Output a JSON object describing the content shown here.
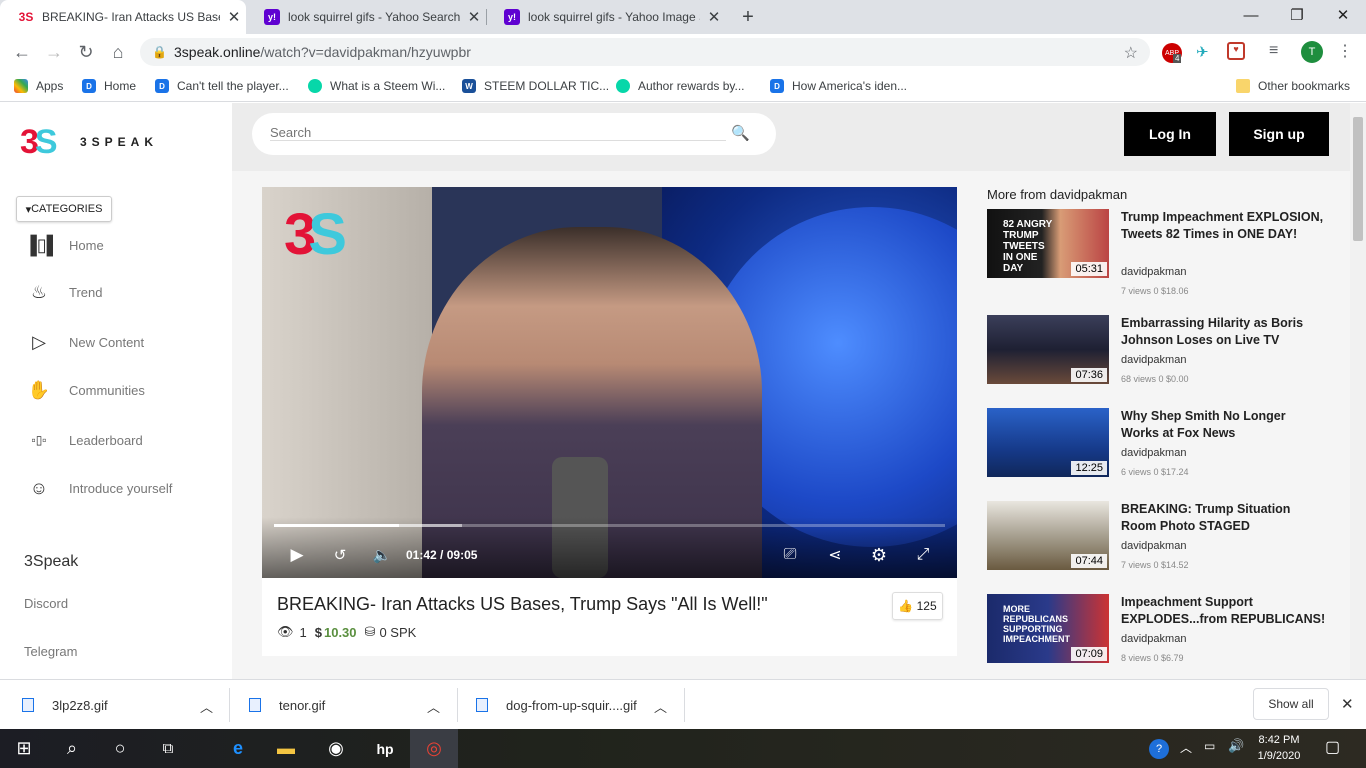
{
  "browser": {
    "tabs": [
      {
        "title": "BREAKING- Iran Attacks US Bases",
        "favicon": "3speak-icon",
        "active": true
      },
      {
        "title": "look squirrel gifs - Yahoo Search",
        "favicon": "yahoo-icon",
        "active": false
      },
      {
        "title": "look squirrel gifs - Yahoo Image S",
        "favicon": "yahoo-icon",
        "active": false
      }
    ],
    "new_tab_label": "+",
    "url_host": "3speak.online",
    "url_path": "/watch?v=davidpakman/hzyuwpbr",
    "extension_badge": "4",
    "profile_initial": "T",
    "bookmarks": [
      {
        "label": "Apps",
        "icon": "apps-grid-icon"
      },
      {
        "label": "Home",
        "icon": "page-icon"
      },
      {
        "label": "Can't tell the player...",
        "icon": "page-icon"
      },
      {
        "label": "What is a Steem Wi...",
        "icon": "steemit-icon"
      },
      {
        "label": "STEEM DOLLAR TIC...",
        "icon": "steem-icon"
      },
      {
        "label": "Author rewards by...",
        "icon": "steemit-icon"
      },
      {
        "label": "How America's iden...",
        "icon": "page-icon"
      }
    ],
    "other_bookmarks": "Other bookmarks"
  },
  "site": {
    "brand": "3SPEAK",
    "categories_label": "CATEGORIES",
    "nav": [
      {
        "label": "Home",
        "icon": "home-icon"
      },
      {
        "label": "Trend",
        "icon": "fire-icon"
      },
      {
        "label": "New Content",
        "icon": "play-outline-icon"
      },
      {
        "label": "Communities",
        "icon": "handshake-icon"
      },
      {
        "label": "Leaderboard",
        "icon": "leaderboard-icon"
      },
      {
        "label": "Introduce yourself",
        "icon": "smile-icon"
      }
    ],
    "section_heading": "3Speak",
    "section_links": [
      "Discord",
      "Telegram"
    ],
    "search_placeholder": "Search",
    "login_label": "Log In",
    "signup_label": "Sign up"
  },
  "video": {
    "title": "BREAKING- Iran Attacks US Bases, Trump Says \"All Is Well!\"",
    "current_time": "01:42",
    "time_separator": "/",
    "duration": "09:05",
    "played_fraction": 0.187,
    "buffered_fraction": 0.28,
    "likes": "125",
    "views": "1",
    "payout": "10.30",
    "payout_symbol": "$",
    "spk": "0 SPK"
  },
  "related": {
    "heading": "More from davidpakman",
    "items": [
      {
        "title": "Trump Impeachment EXPLOSION, Tweets 82 Times in ONE DAY!",
        "author": "davidpakman",
        "duration": "05:31",
        "stats": "7 views 0 $18.06",
        "thumb_text": "82 ANGRY TRUMP TWEETS IN ONE DAY"
      },
      {
        "title": "Embarrassing Hilarity as Boris Johnson Loses on Live TV",
        "author": "davidpakman",
        "duration": "07:36",
        "stats": "68 views 0 $0.00",
        "thumb_text": ""
      },
      {
        "title": "Why Shep Smith No Longer Works at Fox News",
        "author": "davidpakman",
        "duration": "12:25",
        "stats": "6 views 0 $17.24",
        "thumb_text": ""
      },
      {
        "title": "BREAKING: Trump Situation Room Photo STAGED",
        "author": "davidpakman",
        "duration": "07:44",
        "stats": "7 views 0 $14.52",
        "thumb_text": ""
      },
      {
        "title": "Impeachment Support EXPLODES...from REPUBLICANS!",
        "author": "davidpakman",
        "duration": "07:09",
        "stats": "8 views 0 $6.79",
        "thumb_text": "MORE REPUBLICANS SUPPORTING IMPEACHMENT"
      }
    ]
  },
  "downloads": {
    "files": [
      "3lp2z8.gif",
      "tenor.gif",
      "dog-from-up-squir....gif"
    ],
    "show_all": "Show all"
  },
  "taskbar": {
    "time": "8:42 PM",
    "date": "1/9/2020"
  }
}
